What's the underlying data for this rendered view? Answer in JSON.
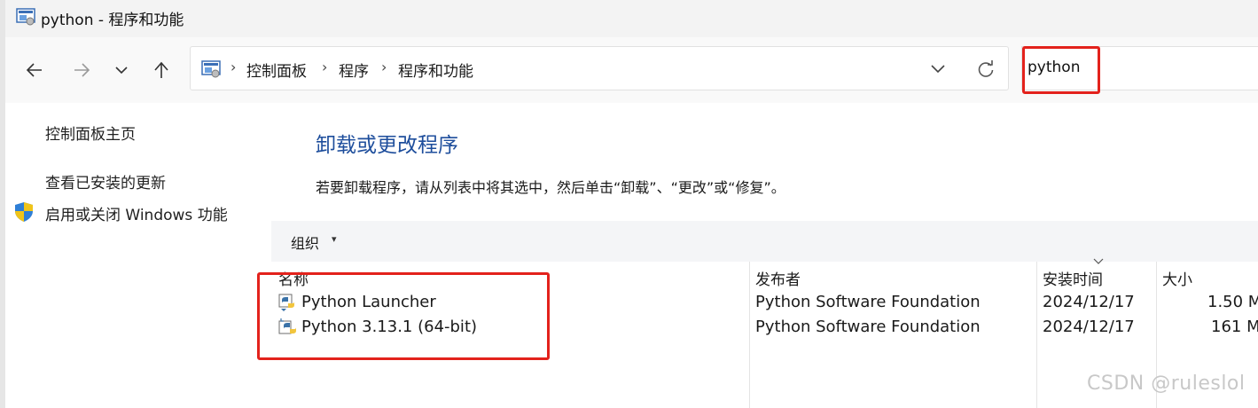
{
  "window": {
    "title": "python - 程序和功能"
  },
  "nav": {
    "back": "back",
    "forward": "forward",
    "recent": "recent",
    "up": "up"
  },
  "address": {
    "breadcrumbs": [
      "控制面板",
      "程序",
      "程序和功能"
    ],
    "separator": "›"
  },
  "search": {
    "value": "python"
  },
  "sidebar": {
    "home": "控制面板主页",
    "updates": "查看已安装的更新",
    "features": "启用或关闭 Windows 功能"
  },
  "main": {
    "title": "卸载或更改程序",
    "description": "若要卸载程序，请从列表中将其选中，然后单击“卸载”、“更改”或“修复”。",
    "toolbar": {
      "organize": "组织",
      "caret": "▾"
    },
    "columns": [
      "名称",
      "发布者",
      "安装时间",
      "大小"
    ],
    "rows": [
      {
        "name": "Python Launcher",
        "publisher": "Python Software Foundation",
        "date": "2024/12/17",
        "size": "1.50 M"
      },
      {
        "name": "Python 3.13.1 (64-bit)",
        "publisher": "Python Software Foundation",
        "date": "2024/12/17",
        "size": "161 M"
      }
    ]
  },
  "watermark": "CSDN @ruleslol",
  "colors": {
    "highlight_border": "#e3221c",
    "title_blue": "#1e4e9c"
  }
}
